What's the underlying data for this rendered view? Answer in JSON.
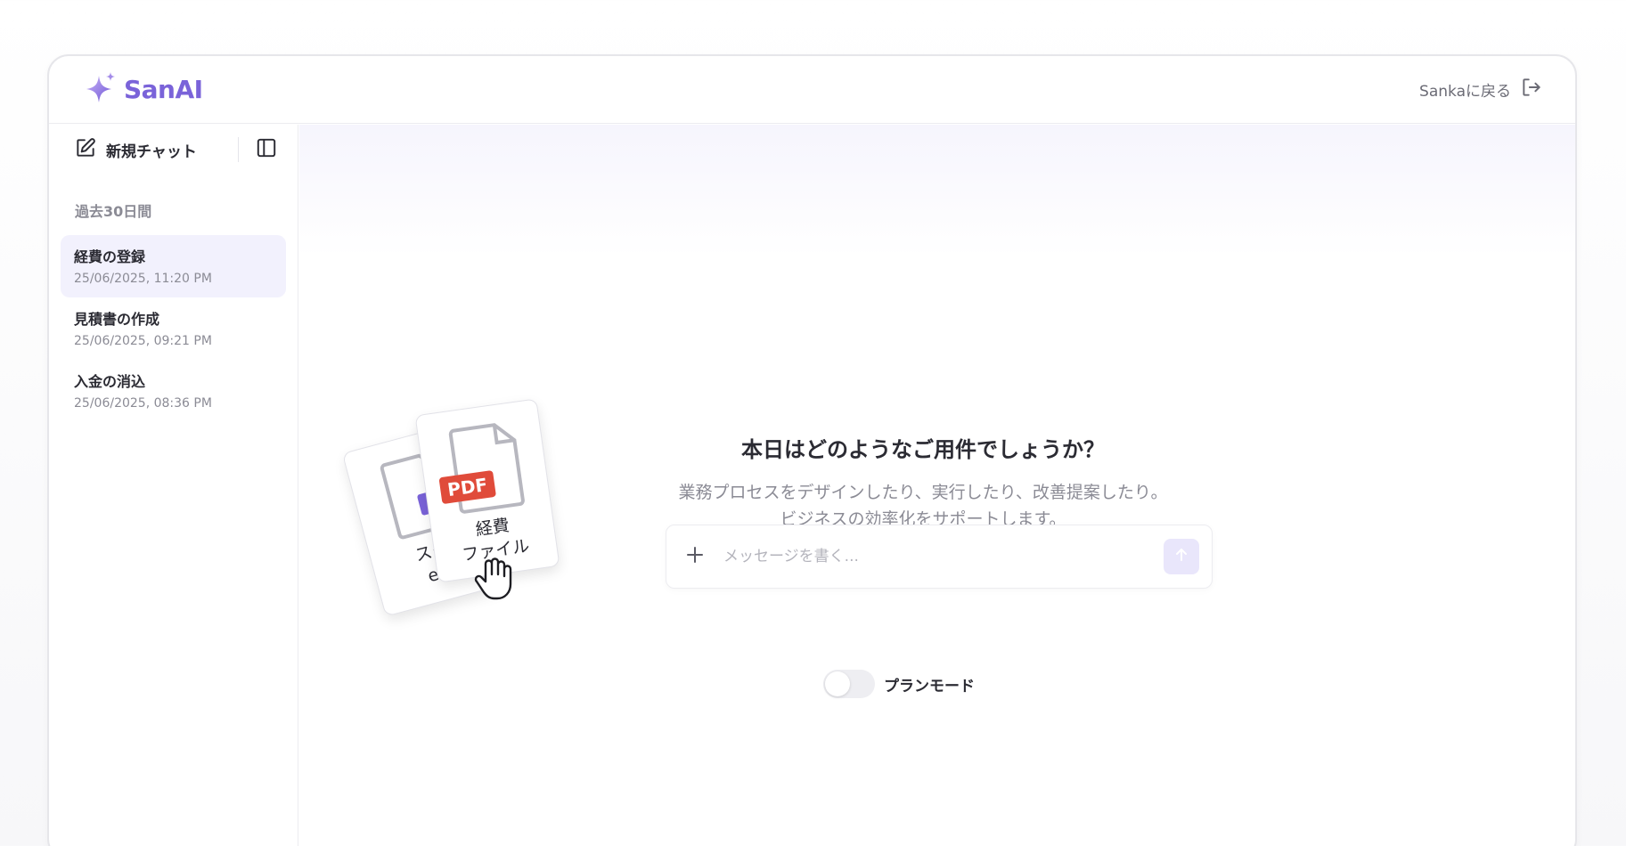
{
  "app": {
    "brand_name": "SanAI",
    "back_label": "Sankaに戻る",
    "accent_color": "#7a63d9"
  },
  "sidebar": {
    "new_chat_label": "新規チャット",
    "section_label": "過去30日間",
    "history": [
      {
        "title": "経費の登録",
        "date": "25/06/2025, 11:20 PM",
        "active": true
      },
      {
        "title": "見積書の作成",
        "date": "25/06/2025, 09:21 PM",
        "active": false
      },
      {
        "title": "入金の消込",
        "date": "25/06/2025, 08:36 PM",
        "active": false
      }
    ]
  },
  "main": {
    "heading": "本日はどのようなご用件でしょうか？",
    "subtitle_line1": "業務プロセスをデザインしたり、実行したり、改善提案したり。",
    "subtitle_line2": "ビジネスの効率化をサポートします。",
    "input_placeholder": "メッセージを書く...",
    "plan_mode_label": "プランモード",
    "plan_mode_on": false
  },
  "illustration": {
    "front_card_badge": "PDF",
    "front_card_line1": "経費",
    "front_card_line2": "ファイル",
    "back_card_line1": "スク",
    "back_card_line2": "ex"
  },
  "icons": [
    "sparkle-logo-icon",
    "logout-icon",
    "edit-icon",
    "sidebar-panel-icon",
    "plus-icon",
    "arrow-up-icon",
    "document-icon",
    "hand-pointer-icon"
  ]
}
